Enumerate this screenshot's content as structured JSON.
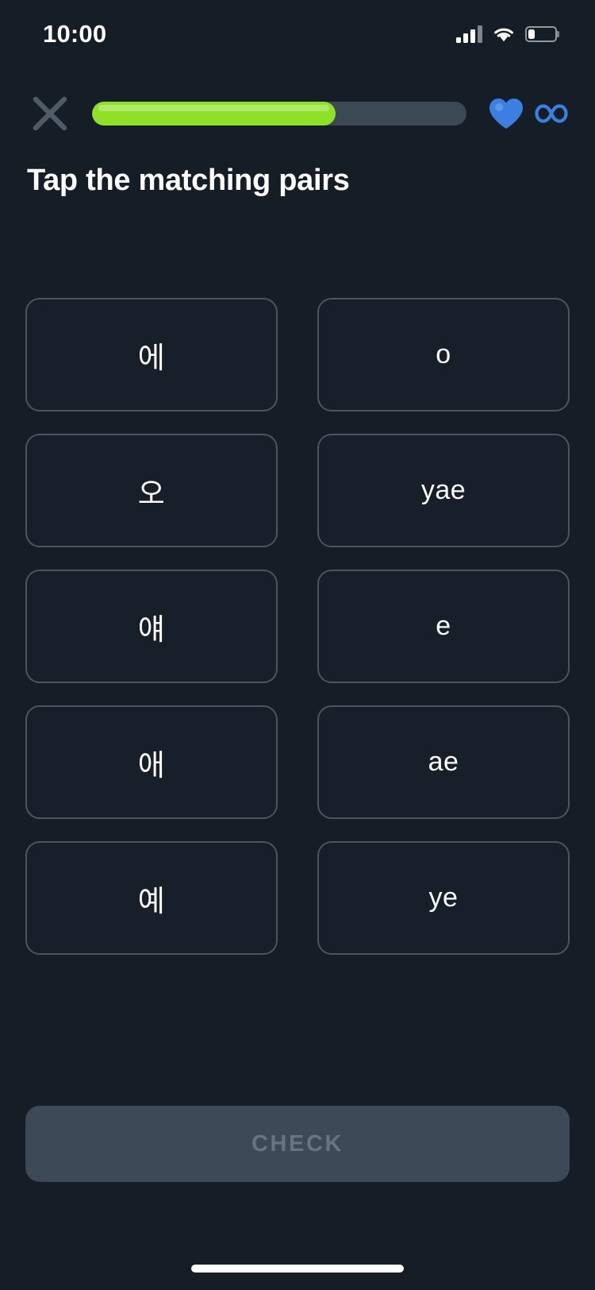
{
  "status_bar": {
    "time": "10:00",
    "signal_icon": "cellular-signal-icon",
    "wifi_icon": "wifi-icon",
    "battery_icon": "battery-icon",
    "battery_level_percent": 25
  },
  "header": {
    "close_icon": "close-x-icon",
    "progress_percent": 65,
    "progress_fill_color": "#8ee028",
    "progress_track_color": "#3d4855",
    "heart_icon": "heart-icon",
    "heart_color": "#3b7fe0",
    "infinity_icon": "infinity-icon",
    "infinity_color": "#3b7fe0"
  },
  "main": {
    "title": "Tap the matching pairs",
    "pairs": [
      {
        "left": "에",
        "right": "o"
      },
      {
        "left": "오",
        "right": "yae"
      },
      {
        "left": "얘",
        "right": "e"
      },
      {
        "left": "애",
        "right": "ae"
      },
      {
        "left": "예",
        "right": "ye"
      }
    ]
  },
  "footer": {
    "check_label": "CHECK",
    "check_enabled": false
  },
  "colors": {
    "page_background": "#151d27",
    "tile_background": "#171f2a",
    "tile_border": "#49555f",
    "check_background": "#3c4956",
    "check_text": "#67757f"
  }
}
